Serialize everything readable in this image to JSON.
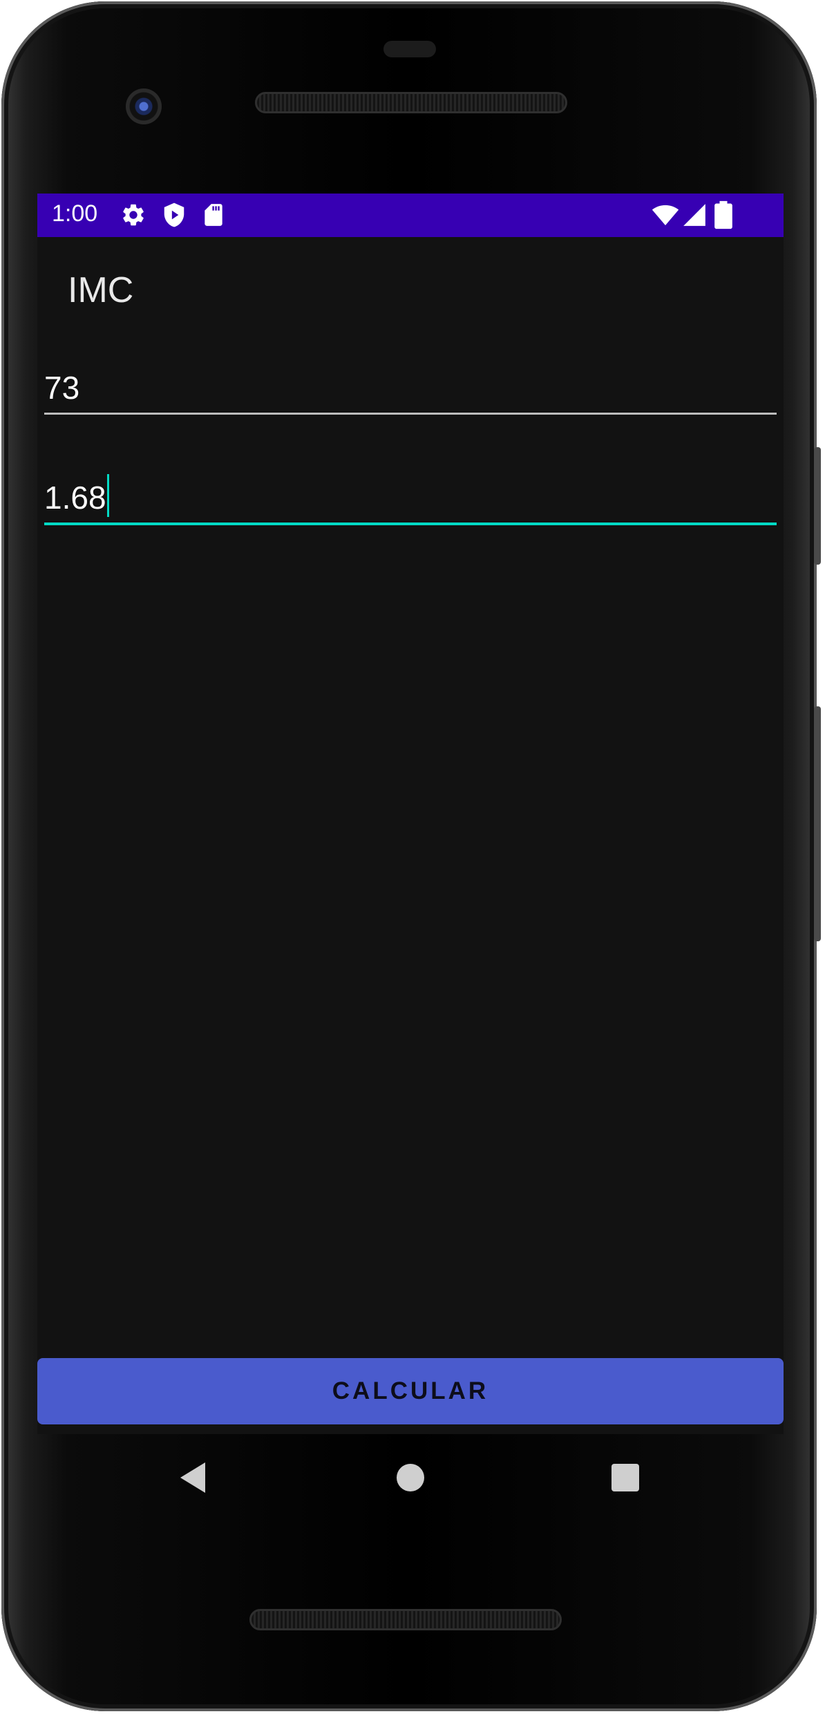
{
  "status_bar": {
    "time": "1:00",
    "left_icons": [
      "gear-icon",
      "shield-play-icon",
      "sd-card-icon"
    ],
    "right_icons": [
      "wifi-icon",
      "cell-signal-icon",
      "battery-icon"
    ],
    "background": "#3700b3"
  },
  "app_bar": {
    "title": "IMC"
  },
  "form": {
    "weight_value": "73",
    "height_value": "1.68"
  },
  "calculate_button": {
    "label": "CALCULAR",
    "color": "#4a5bcd"
  },
  "nav_bar": {
    "icons": [
      "back-icon",
      "home-icon",
      "recents-icon"
    ]
  },
  "colors": {
    "accent": "#03dac5",
    "background": "#121212"
  }
}
